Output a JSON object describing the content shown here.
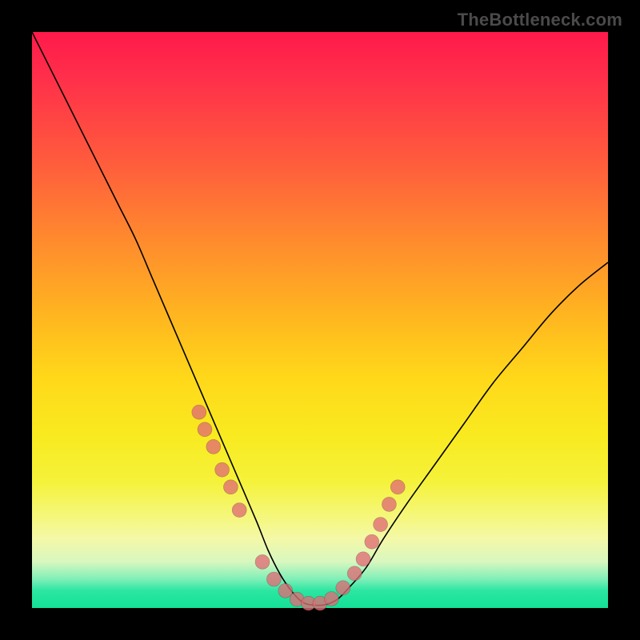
{
  "watermark": "TheBottleneck.com",
  "chart_data": {
    "type": "line",
    "title": "",
    "xlabel": "",
    "ylabel": "",
    "xlim": [
      0,
      100
    ],
    "ylim": [
      0,
      100
    ],
    "series": [
      {
        "name": "bottleneck-curve",
        "x": [
          0,
          3,
          6,
          9,
          12,
          15,
          18,
          21,
          24,
          27,
          30,
          33,
          36,
          39,
          41,
          43,
          45,
          47,
          49,
          51,
          53,
          55,
          58,
          61,
          65,
          70,
          75,
          80,
          85,
          90,
          95,
          100
        ],
        "y": [
          100,
          94,
          88,
          82,
          76,
          70,
          64,
          57,
          50,
          43,
          36,
          29,
          22,
          15,
          10,
          6,
          3,
          1,
          0.5,
          0.6,
          1.5,
          3.5,
          7,
          12,
          18,
          25,
          32,
          39,
          45,
          51,
          56,
          60
        ]
      }
    ],
    "markers": {
      "name": "highlighted-points",
      "x": [
        29,
        30,
        31.5,
        33,
        34.5,
        36,
        40,
        42,
        44,
        46,
        48,
        50,
        52,
        54,
        56,
        57.5,
        59,
        60.5,
        62,
        63.5
      ],
      "y": [
        34,
        31,
        28,
        24,
        21,
        17,
        8,
        5,
        3,
        1.5,
        0.8,
        0.8,
        1.6,
        3.5,
        6,
        8.5,
        11.5,
        14.5,
        18,
        21
      ]
    },
    "gradient_stops": [
      {
        "pos": 0.0,
        "color": "#ff1a4b"
      },
      {
        "pos": 0.5,
        "color": "#ffd81a"
      },
      {
        "pos": 0.88,
        "color": "#f4f8a8"
      },
      {
        "pos": 1.0,
        "color": "#13e196"
      }
    ]
  }
}
